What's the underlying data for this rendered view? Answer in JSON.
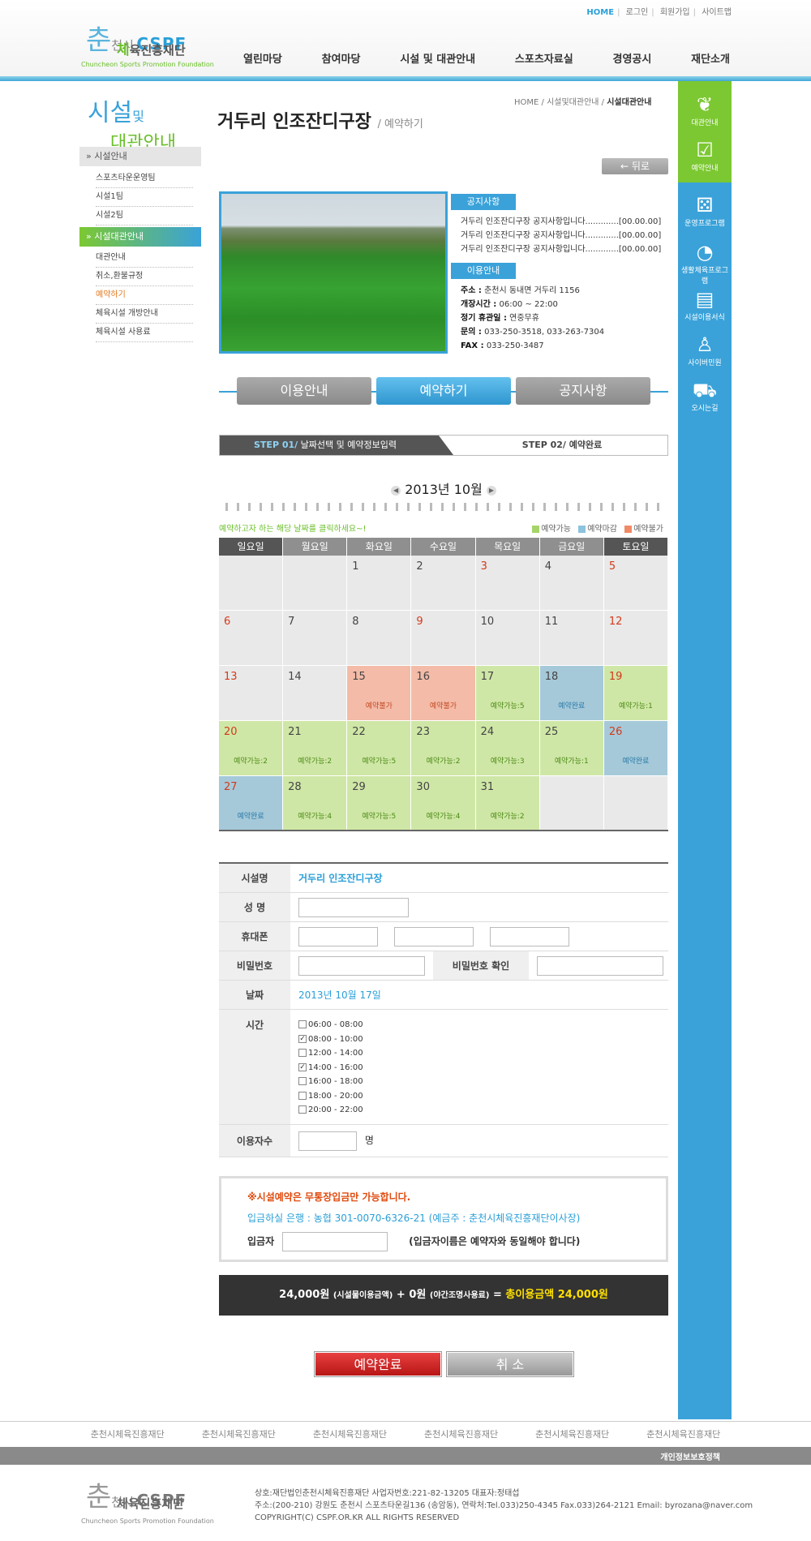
{
  "header": {
    "toplinks": [
      "HOME",
      "로그인",
      "회원가입",
      "사이트맵"
    ],
    "logo": {
      "big": "춘",
      "si": "천시",
      "cspf": "CSPF",
      "green": "체",
      "sub": "육진흥재단",
      "eng": "Chuncheon Sports Promotion Foundation"
    },
    "nav": [
      "열린마당",
      "참여마당",
      "시설 및 대관안내",
      "스포츠자료실",
      "경영공시",
      "재단소개"
    ]
  },
  "lnb": {
    "title_a": "시설",
    "title_b": "및",
    "title_c": "대관안내",
    "head1": "» 시설안내",
    "items1": [
      "스포츠타운운영팀",
      "시설1팀",
      "시설2팀"
    ],
    "head2": "» 시설대관안내",
    "items2": [
      "대관안내",
      "취소,환불규정",
      "예약하기",
      "체육시설 개방안내",
      "체육시설 사용료"
    ]
  },
  "quick": [
    "대관안내",
    "예약안내",
    "운영프로그램",
    "생활체육프로그램",
    "시설이용서식",
    "사이버민원",
    "오시는길"
  ],
  "page": {
    "title": "거두리 인조잔디구장",
    "subtitle": "/ 예약하기",
    "crumb": [
      "HOME",
      "시설및대관안내",
      "시설대관안내"
    ],
    "back": "← 뒤로"
  },
  "notice": {
    "tag": "공지사항",
    "items": [
      "거두리 인조잔디구장 공지사항입니다.............[00.00.00]",
      "거두리 인조잔디구장 공지사항입니다.............[00.00.00]",
      "거두리 인조잔디구장 공지사항입니다.............[00.00.00]"
    ]
  },
  "usage": {
    "tag": "이용안내",
    "rows": [
      {
        "k": "주소 :",
        "v": "춘천시 동내면 거두리 1156"
      },
      {
        "k": "개장시간 :",
        "v": "06:00 ~ 22:00"
      },
      {
        "k": "정기 휴관일 :",
        "v": "연중무휴"
      },
      {
        "k": "문의 :",
        "v": "033-250-3518, 033-263-7304"
      },
      {
        "k": "FAX :",
        "v": "033-250-3487"
      }
    ]
  },
  "tabs": [
    "이용안내",
    "예약하기",
    "공지사항"
  ],
  "steps": {
    "s1_num": "STEP 01/",
    "s1_text": "날짜선택 및 예약정보입력",
    "s2": "STEP 02/ 예약완료"
  },
  "calendar": {
    "month": "2013년 10월",
    "hint": "예약하고자 하는 해당 날짜를 클릭하세요~!",
    "legend": [
      {
        "label": "예약가능",
        "color": "#a6d46a"
      },
      {
        "label": "예약마감",
        "color": "#8cc3de"
      },
      {
        "label": "예약불가",
        "color": "#f08a66"
      }
    ],
    "weekdays": [
      "일요일",
      "월요일",
      "화요일",
      "수요일",
      "목요일",
      "금요일",
      "토요일"
    ],
    "weeks": [
      [
        {
          "d": ""
        },
        {
          "d": ""
        },
        {
          "d": "1"
        },
        {
          "d": "2"
        },
        {
          "d": "3",
          "red": true
        },
        {
          "d": "4"
        },
        {
          "d": "5",
          "red": true
        }
      ],
      [
        {
          "d": "6",
          "red": true
        },
        {
          "d": "7"
        },
        {
          "d": "8"
        },
        {
          "d": "9",
          "red": true
        },
        {
          "d": "10"
        },
        {
          "d": "11"
        },
        {
          "d": "12",
          "red": true
        }
      ],
      [
        {
          "d": "13",
          "red": true
        },
        {
          "d": "14"
        },
        {
          "d": "15",
          "s": "na",
          "t": "예약불가"
        },
        {
          "d": "16",
          "s": "na",
          "t": "예약불가"
        },
        {
          "d": "17",
          "s": "av",
          "t": "예약가능:5"
        },
        {
          "d": "18",
          "s": "cl",
          "t": "예약완료"
        },
        {
          "d": "19",
          "red": true,
          "s": "av",
          "t": "예약가능:1"
        }
      ],
      [
        {
          "d": "20",
          "red": true,
          "s": "av",
          "t": "예약가능:2"
        },
        {
          "d": "21",
          "s": "av",
          "t": "예약가능:2"
        },
        {
          "d": "22",
          "s": "av",
          "t": "예약가능:5"
        },
        {
          "d": "23",
          "s": "av",
          "t": "예약가능:2"
        },
        {
          "d": "24",
          "s": "av",
          "t": "예약가능:3"
        },
        {
          "d": "25",
          "s": "av",
          "t": "예약가능:1"
        },
        {
          "d": "26",
          "red": true,
          "s": "cl",
          "t": "예약완료"
        }
      ],
      [
        {
          "d": "27",
          "red": true,
          "s": "cl",
          "t": "예약완료"
        },
        {
          "d": "28",
          "s": "av",
          "t": "예약가능:4"
        },
        {
          "d": "29",
          "s": "av",
          "t": "예약가능:5"
        },
        {
          "d": "30",
          "s": "av",
          "t": "예약가능:4"
        },
        {
          "d": "31",
          "s": "av",
          "t": "예약가능:2"
        },
        {
          "d": ""
        },
        {
          "d": ""
        }
      ]
    ]
  },
  "form": {
    "facility_label": "시설명",
    "facility": "거두리 인조잔디구장",
    "name_label": "성 명",
    "phone_label": "휴대폰",
    "pw_label": "비밀번호",
    "pw2_label": "비밀번호 확인",
    "date_label": "날짜",
    "date": "2013년 10월 17일",
    "time_label": "시간",
    "times": [
      {
        "t": "06:00 - 08:00",
        "c": false
      },
      {
        "t": "08:00 - 10:00",
        "c": true
      },
      {
        "t": "12:00 - 14:00",
        "c": false
      },
      {
        "t": "14:00 - 16:00",
        "c": true
      },
      {
        "t": "16:00 - 18:00",
        "c": false
      },
      {
        "t": "18:00 - 20:00",
        "c": false
      },
      {
        "t": "20:00 - 22:00",
        "c": false
      }
    ],
    "people_label": "이용자수",
    "people_unit": "명"
  },
  "bank": {
    "l1": "※시설예약은 무통장입금만 가능합니다.",
    "l2": "입금하실 은행 : 농협 301-0070-6326-21 (예금주 : 춘천시체육진흥재단이사장)",
    "l3_label": "입금자",
    "l3_note": "(입금자이름은 예약자와 동일해야 합니다)"
  },
  "total": {
    "a": "24,000원",
    "a_note": "(시설물이용금액)",
    "b": "+ 0원",
    "b_note": "(야간조명사용료)",
    "eq": "=",
    "c": "총이용금액 24,000원"
  },
  "buttons": {
    "ok": "예약완료",
    "cancel": "취 소"
  },
  "footer": {
    "links": [
      "춘천시체육진흥재단",
      "춘천시체육진흥재단",
      "춘천시체육진흥재단",
      "춘천시체육진흥재단",
      "춘천시체육진흥재단",
      "춘천시체육진흥재단"
    ],
    "privacy": "개인정보보호정책",
    "info": [
      "상호:재단법인춘천시체육진흥재단 사업자번호:221-82-13205 대표자:정태섭",
      "주소:(200-210) 강원도 춘천시 스포츠타운길136 (송암동), 연락처:Tel.033)250-4345 Fax.033)264-2121 Email: byrozana@naver.com",
      "COPYRIGHT(C) CSPF.OR.KR ALL RIGHTS RESERVED"
    ]
  }
}
